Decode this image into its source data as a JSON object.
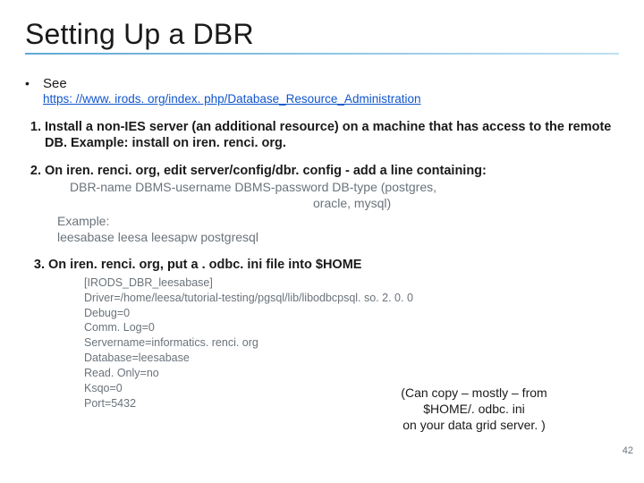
{
  "title": "Setting Up a DBR",
  "see_label": "See",
  "link_text": "https: //www. irods. org/index. php/Database_Resource_Administration",
  "step1": "Install a non-IES server (an additional resource) on a machine that has access to the remote DB.  Example: install on iren. renci. org.",
  "step2": "On iren. renci. org, edit server/config/dbr. config - add a line containing:",
  "step2_syntax_a": "DBR-name  DBMS-username  DBMS-password  DB-type (postgres,",
  "step2_syntax_b": "oracle, mysql)",
  "step2_example_label": "Example:",
  "step2_example": "leesabase  leesa  leesapw  postgresql",
  "step3": "On iren. renci. org, put a . odbc. ini file into $HOME",
  "odbc": {
    "l1": "[IRODS_DBR_leesabase]",
    "l2": "Driver=/home/leesa/tutorial-testing/pgsql/lib/libodbcpsql. so. 2. 0. 0",
    "l3": "Debug=0",
    "l4": "Comm. Log=0",
    "l5": "Servername=informatics. renci. org",
    "l6": "Database=leesabase",
    "l7": "Read. Only=no",
    "l8": "Ksqo=0",
    "l9": "Port=5432"
  },
  "note_l1": "(Can copy – mostly – from",
  "note_l2": "$HOME/. odbc. ini",
  "note_l3": "on your data grid server. )",
  "page_number": "42"
}
